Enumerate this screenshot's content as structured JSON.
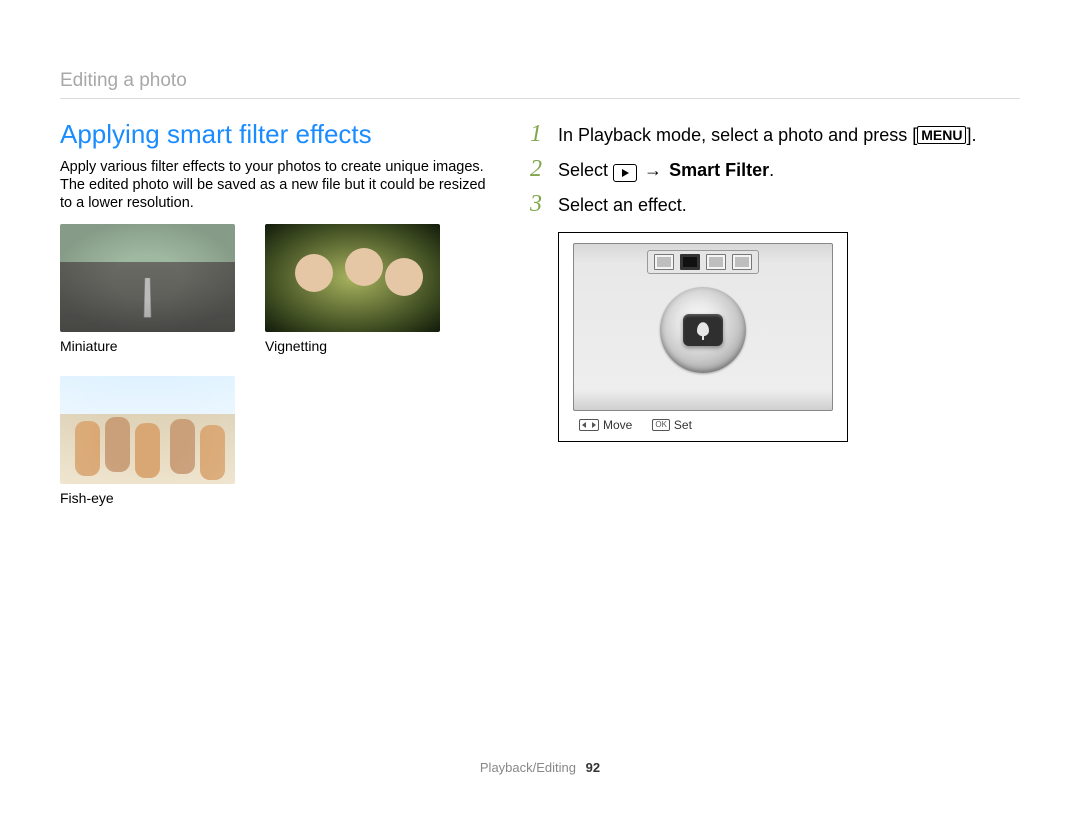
{
  "breadcrumb": "Editing a photo",
  "section_title": "Applying smart filter effects",
  "intro": "Apply various filter effects to your photos to create unique images. The edited photo will be saved as a new file but it could be resized to a lower resolution.",
  "examples": [
    {
      "label": "Miniature"
    },
    {
      "label": "Vignetting"
    },
    {
      "label": "Fish-eye"
    }
  ],
  "steps": {
    "s1": {
      "num": "1",
      "prefix": "In Playback mode, select a photo and press [",
      "menu_label": "MENU",
      "suffix": "]."
    },
    "s2": {
      "num": "2",
      "prefix": "Select ",
      "arrow": "→",
      "bold": "Smart Filter",
      "suffix": "."
    },
    "s3": {
      "num": "3",
      "text": "Select an effect."
    }
  },
  "lcd": {
    "move_label": "Move",
    "ok_label": "OK",
    "set_label": "Set"
  },
  "footer": {
    "section": "Playback/Editing",
    "page": "92"
  }
}
